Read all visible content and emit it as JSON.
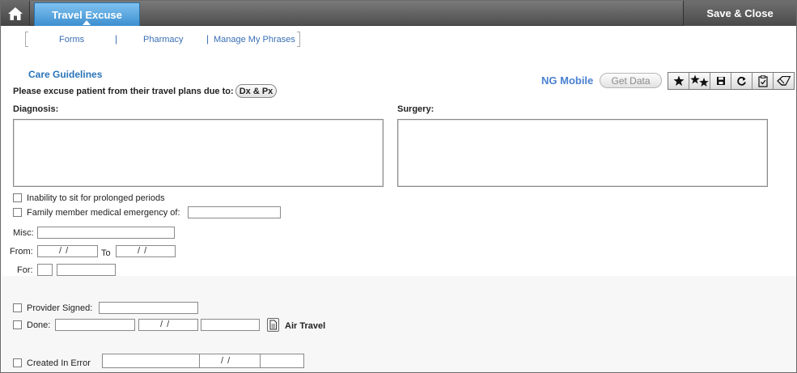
{
  "header": {
    "home_icon": "home-icon",
    "active_tab": "Travel Excuse",
    "save_close": "Save & Close"
  },
  "subnav": {
    "items": [
      "Forms",
      "Pharmacy",
      "Manage My Phrases"
    ]
  },
  "care_guidelines": "Care Guidelines",
  "excuse_prompt": "Please excuse patient from their travel plans due to:",
  "dxpx_button": "Dx & Px",
  "ng_mobile": "NG Mobile",
  "get_data": "Get Data",
  "toolbar_icons": [
    "star-icon",
    "two-stars-icon",
    "save-icon",
    "refresh-icon",
    "clipboard-check-icon",
    "eraser-icon"
  ],
  "diagnosis_label": "Diagnosis:",
  "surgery_label": "Surgery:",
  "checks": {
    "inability": "Inability to sit for prolonged periods",
    "family": "Family member medical emergency of:"
  },
  "misc_label": "Misc:",
  "from_label": "From:",
  "to_label": "To",
  "for_label": "For:",
  "date_placeholder": "/ /",
  "provider_signed": "Provider Signed:",
  "done_label": "Done:",
  "air_travel": "Air Travel",
  "created_in_error": "Created In Error",
  "colors": {
    "tab_blue": "#3c8fd0",
    "link_blue": "#3a6fb5",
    "header_gray": "#4e4e4e"
  }
}
